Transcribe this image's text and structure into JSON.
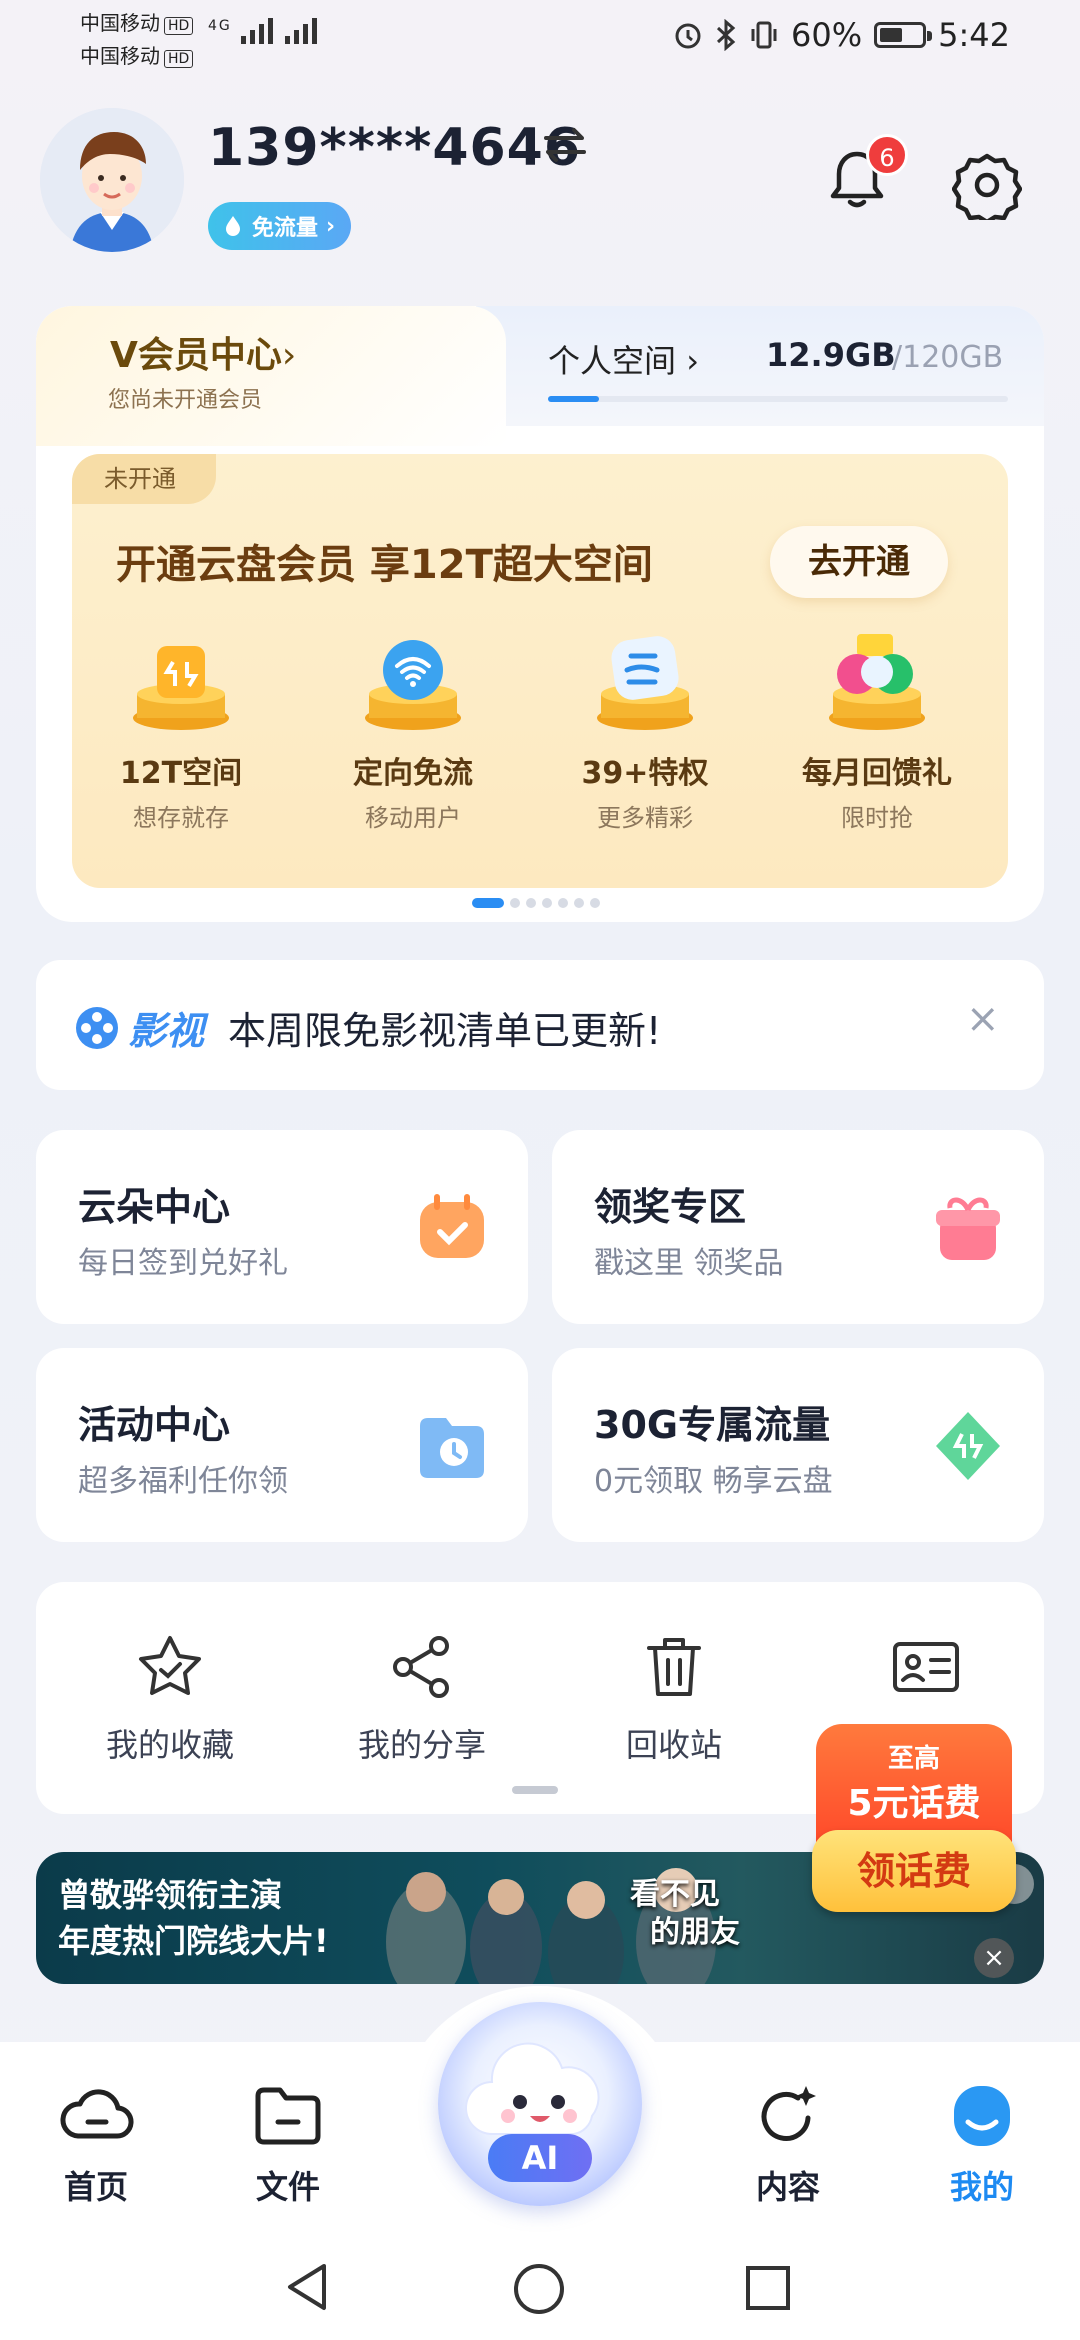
{
  "status_bar": {
    "carrier1": "中国移动",
    "carrier2": "中国移动",
    "hd": "HD",
    "network": "4G",
    "battery": "60%",
    "battery_level": 0.6,
    "time": "5:42"
  },
  "profile": {
    "phone": "139****4646",
    "free_traffic": "免流量",
    "notification_count": "6"
  },
  "member": {
    "title": "V会员中心",
    "subtitle": "您尚未开通会员",
    "space_label": "个人空间",
    "space_used": "12.9GB",
    "space_total": "/120GB",
    "space_fraction": 0.11
  },
  "promo": {
    "tag": "未开通",
    "title": "开通云盘会员  享12T超大空间",
    "button": "去开通",
    "perks": [
      {
        "name": "12T空间",
        "desc": "想存就存",
        "icon": "storage-icon"
      },
      {
        "name": "定向免流",
        "desc": "移动用户",
        "icon": "wifi-icon"
      },
      {
        "name": "39+特权",
        "desc": "更多精彩",
        "icon": "cloud-privilege-icon"
      },
      {
        "name": "每月回馈礼",
        "desc": "限时抢",
        "icon": "gift-box-icon"
      }
    ]
  },
  "notice": {
    "logo": "影视",
    "text": "本周限免影视清单已更新!",
    "close": "×"
  },
  "tiles": [
    {
      "title": "云朵中心",
      "desc": "每日签到兑好礼",
      "icon": "calendar-icon"
    },
    {
      "title": "领奖专区",
      "desc": "戳这里 领奖品",
      "icon": "gift-icon"
    },
    {
      "title": "活动中心",
      "desc": "超多福利任你领",
      "icon": "folder-clock-icon"
    },
    {
      "title": "30G专属流量",
      "desc": "0元领取 畅享云盘",
      "icon": "traffic-icon"
    }
  ],
  "quick": [
    {
      "label": "我的收藏",
      "icon": "star-icon"
    },
    {
      "label": "我的分享",
      "icon": "share-icon"
    },
    {
      "label": "回收站",
      "icon": "trash-icon"
    },
    {
      "label": "我的证件",
      "icon": "id-card-icon"
    }
  ],
  "banner": {
    "line1": "曾敬骅领衔主演",
    "line2": "年度热门院线大片!",
    "movie_title_1": "看不见",
    "movie_title_2": "的朋友"
  },
  "coupon": {
    "line1": "至高",
    "line2": "5元话费",
    "button": "领话费",
    "close": "×"
  },
  "nav": {
    "home": "首页",
    "files": "文件",
    "ai": "AI",
    "content": "内容",
    "mine": "我的"
  }
}
